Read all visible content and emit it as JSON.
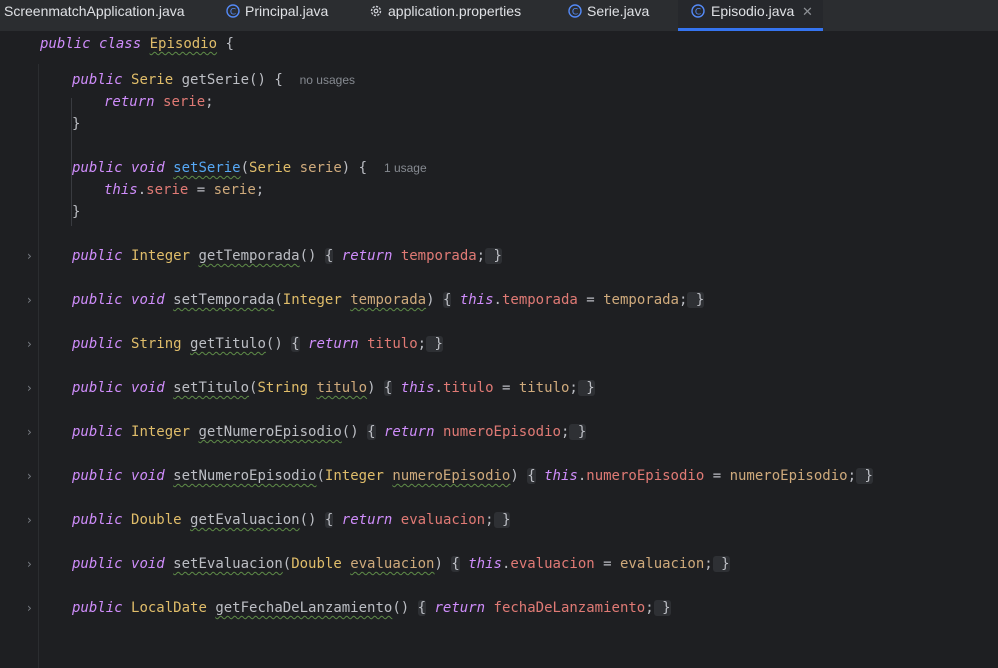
{
  "tabs": [
    {
      "label": "ScreenmatchApplication.java",
      "icon": "java-file-icon"
    },
    {
      "label": "Principal.java",
      "icon": "class-icon"
    },
    {
      "label": "application.properties",
      "icon": "gear-icon"
    },
    {
      "label": "Serie.java",
      "icon": "class-icon"
    },
    {
      "label": "Episodio.java",
      "icon": "class-icon",
      "active": true
    }
  ],
  "editor": {
    "class_decl": {
      "kw1": "public",
      "kw2": "class",
      "name": "Episodio",
      "open": "{"
    },
    "getSerie": {
      "kw": "public",
      "type": "Serie",
      "name": "getSerie",
      "sig": "() {",
      "hint": "no usages",
      "body_kw": "return",
      "body_field": "serie",
      "body_end": ";",
      "close": "}"
    },
    "setSerie": {
      "kw": "public",
      "kw2": "void",
      "name": "setSerie",
      "open_paren": "(",
      "ptype": "Serie",
      "pname": "serie",
      "close_sig": ") {",
      "hint": "1 usage",
      "body_kw": "this",
      "body_dot": ".",
      "body_field": "serie",
      "body_eq": " = ",
      "body_val": "serie",
      "body_end": ";",
      "close": "}"
    },
    "methods": [
      {
        "text": "public Integer getTemporada() { return temporada; }"
      },
      {
        "text": "public void setTemporada(Integer temporada) { this.temporada = temporada; }"
      },
      {
        "text": "public String getTitulo() { return titulo; }"
      },
      {
        "text": "public void setTitulo(String titulo) { this.titulo = titulo; }"
      },
      {
        "text": "public Integer getNumeroEpisodio() { return numeroEpisodio; }"
      },
      {
        "text": "public void setNumeroEpisodio(Integer numeroEpisodio) { this.numeroEpisodio = numeroEpisodio; }"
      },
      {
        "text": "public Double getEvaluacion() { return evaluacion; }"
      },
      {
        "text": "public void setEvaluacion(Double evaluacion) { this.evaluacion = evaluacion; }"
      },
      {
        "text": "public LocalDate getFechaDeLanzamiento() { return fechaDeLanzamiento; }"
      }
    ]
  },
  "colors": {
    "keyword": "#cf8dfb",
    "type": "#e0bd6a",
    "method": "#56a8f5",
    "field": "#e07a75",
    "param": "#cfaa7c",
    "accent": "#3574f0"
  }
}
